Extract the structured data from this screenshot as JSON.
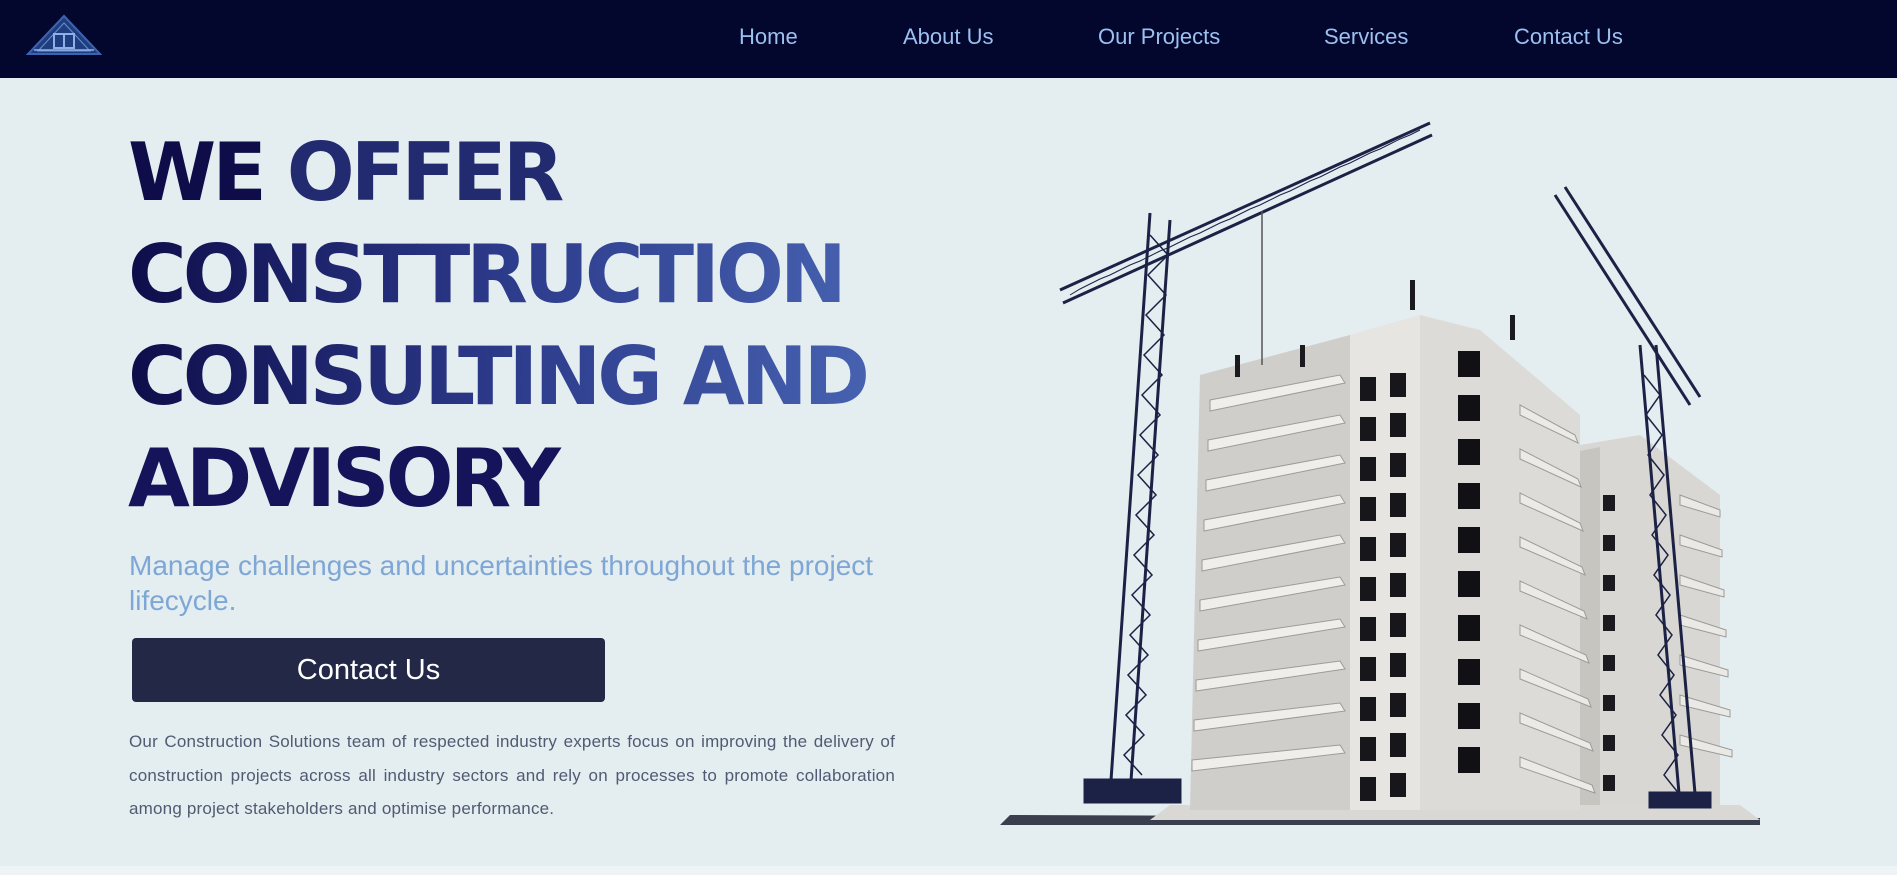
{
  "header": {
    "logo_icon": "house-logo-icon",
    "nav": [
      {
        "label": "Home"
      },
      {
        "label": "About Us"
      },
      {
        "label": "Our Projects"
      },
      {
        "label": "Services"
      },
      {
        "label": "Contact Us"
      }
    ]
  },
  "hero": {
    "title_line1_a": "WE ",
    "title_line1_b": "OFFER",
    "title_line2": "CONSTTRUCTION",
    "title_line3": "CONSULTING AND",
    "title_line4": "ADVISORY",
    "subtitle": "Manage challenges and uncertainties throughout the project lifecycle.",
    "cta_label": "Contact Us",
    "description": "Our Construction Solutions team of respected industry experts focus on improving the delivery of construction projects across all industry sectors and rely on processes to promote collaboration among project stakeholders and optimise performance."
  },
  "colors": {
    "header_bg": "#03072e",
    "page_bg": "#e4edf0",
    "nav_text": "#9cc0f0",
    "title_dark": "#0e0d4a",
    "title_light": "#4c6ab8",
    "subtitle": "#7ea7d6",
    "button_bg": "#222845"
  },
  "illustration": {
    "icon": "building-with-cranes-illustration"
  }
}
